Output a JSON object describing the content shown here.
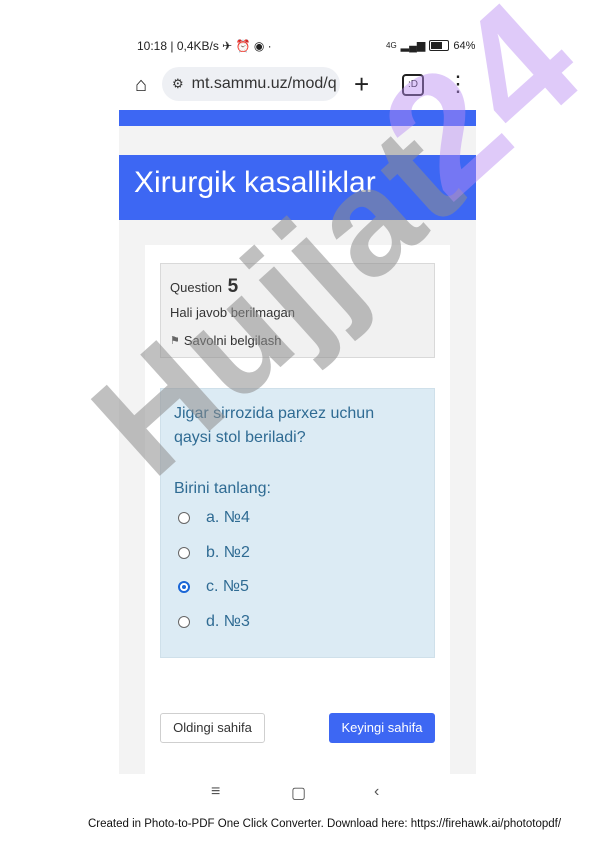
{
  "status": {
    "left": "10:18 | 0,4KB/s ✈ ⏰ ◉ ·",
    "network": "4G",
    "battery": "64%"
  },
  "browser": {
    "url": "mt.sammu.uz/mod/q",
    "tab_count": ":D"
  },
  "page": {
    "title": "Xirurgik kasalliklar"
  },
  "question_info": {
    "label": "Question",
    "number": "5",
    "state": "Hali javob berilmagan",
    "flag_label": "Savolni belgilash"
  },
  "question": {
    "text": "Jigar sirrozida parxez uchun qaysi stol beriladi?",
    "prompt": "Birini tanlang:",
    "options": [
      {
        "label": "a. №4",
        "checked": false
      },
      {
        "label": "b. №2",
        "checked": false
      },
      {
        "label": "c. №5",
        "checked": true
      },
      {
        "label": "d. №3",
        "checked": false
      }
    ]
  },
  "buttons": {
    "prev": "Oldingi sahifa",
    "next": "Keyingi sahifa"
  },
  "watermark": {
    "word": "Hujjat",
    "number": "24"
  },
  "footer": "Created in Photo-to-PDF One Click Converter. Download here: https://firehawk.ai/phototopdf/",
  "colors": {
    "accent": "#3d67f3",
    "question_bg": "#dcebf4",
    "question_text": "#2f6b93"
  }
}
